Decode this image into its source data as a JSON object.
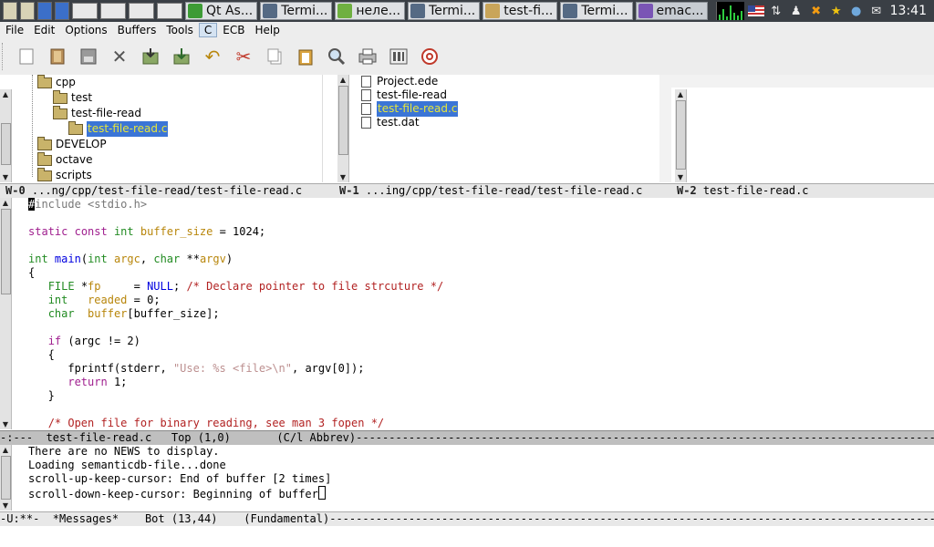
{
  "taskbar": {
    "tasks": [
      {
        "label": "Qt As...",
        "color": "#3d9b35"
      },
      {
        "label": "Termi...",
        "color": "#556a84"
      },
      {
        "label": "нeле...",
        "color": "#6fb040"
      },
      {
        "label": "Termi...",
        "color": "#556a84"
      },
      {
        "label": "test-fi...",
        "color": "#c9a55a"
      },
      {
        "label": "Termi...",
        "color": "#556a84"
      },
      {
        "label": "emac...",
        "color": "#7a55b5"
      }
    ],
    "clock": "13:41"
  },
  "menubar": {
    "items": [
      "File",
      "Edit",
      "Options",
      "Buffers",
      "Tools",
      "C",
      "ECB",
      "Help"
    ],
    "active": "C"
  },
  "toolbar": {
    "icons": [
      "new-file-icon",
      "open-file-icon",
      "save-icon",
      "close-icon",
      "save-as-icon",
      "download-icon",
      "undo-icon",
      "cut-icon",
      "copy-icon",
      "paste-icon",
      "search-icon",
      "print-icon",
      "preferences-icon",
      "help-icon"
    ]
  },
  "ecb": {
    "directories": [
      {
        "name": "cpp",
        "indent": 0
      },
      {
        "name": "test",
        "indent": 1
      },
      {
        "name": "test-file-read",
        "indent": 1
      },
      {
        "name": "test-file-read.c",
        "indent": 2,
        "selected": true
      },
      {
        "name": "DEVELOP",
        "indent": 0
      },
      {
        "name": "octave",
        "indent": 0
      },
      {
        "name": "scripts",
        "indent": 0
      }
    ],
    "sources": [
      {
        "name": "Project.ede"
      },
      {
        "name": "test-file-read"
      },
      {
        "name": "test-file-read.c",
        "selected": true
      },
      {
        "name": "test.dat"
      }
    ],
    "modelines": {
      "w0": {
        "id": "W-0",
        "text": "...ng/cpp/test-file-read/test-file-read.c"
      },
      "w1": {
        "id": "W-1",
        "text": "...ing/cpp/test-file-read/test-file-read.c"
      },
      "w2": {
        "id": "W-2",
        "text": "test-file-read.c"
      }
    }
  },
  "code": {
    "modeline": "-:---  test-file-read.c   Top (1,0)       (C/l Abbrev)-------------------------------------------------------------------------------------------------------------------"
  },
  "messages": {
    "lines": [
      "There are no NEWS to display.",
      "Loading semanticdb-file...done",
      "scroll-up-keep-cursor: End of buffer [2 times]",
      "scroll-down-keep-cursor: Beginning of buffer"
    ],
    "modeline": "-U:**-  *Messages*    Bot (13,44)    (Fundamental)-----------------------------------------------------------------------------------------------------------------------"
  }
}
